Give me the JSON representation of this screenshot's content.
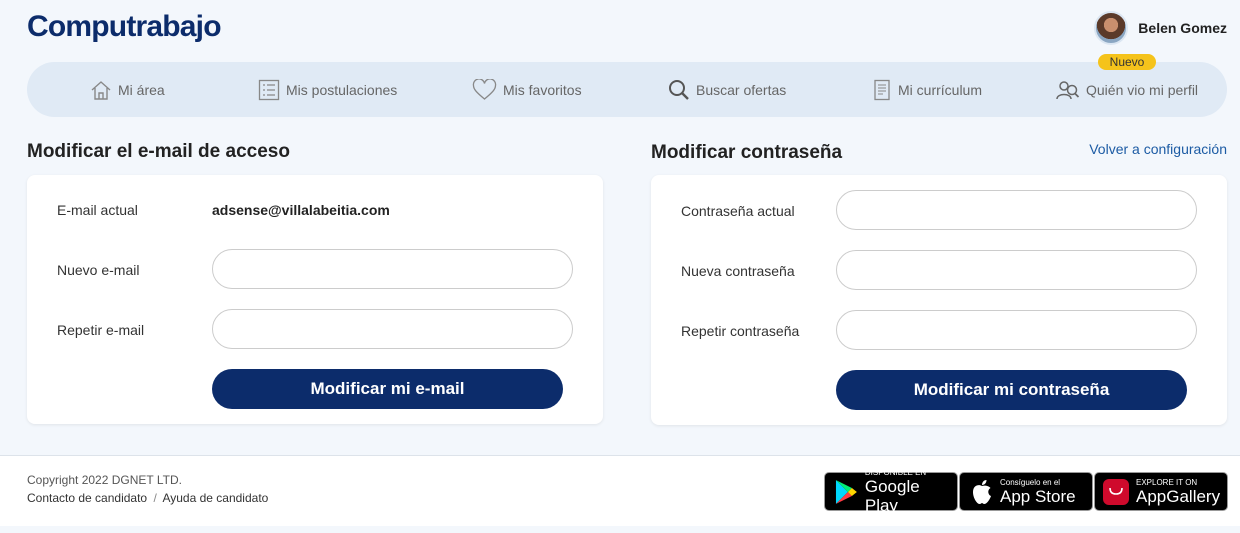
{
  "header": {
    "logo": "Computrabajo",
    "user_name": "Belen Gomez",
    "badge": "Nuevo"
  },
  "nav": {
    "items": [
      {
        "label": "Mi área",
        "icon": "home-icon"
      },
      {
        "label": "Mis postulaciones",
        "icon": "list-icon"
      },
      {
        "label": "Mis favoritos",
        "icon": "heart-icon"
      },
      {
        "label": "Buscar ofertas",
        "icon": "search-icon"
      },
      {
        "label": "Mi currículum",
        "icon": "document-icon"
      },
      {
        "label": "Quién vio mi perfil",
        "icon": "user-search-icon"
      }
    ]
  },
  "email_section": {
    "title": "Modificar el e-mail de acceso",
    "current_label": "E-mail actual",
    "current_value": "adsense@villalabeitia.com",
    "new_label": "Nuevo e-mail",
    "new_value": "",
    "repeat_label": "Repetir e-mail",
    "repeat_value": "",
    "button": "Modificar mi e-mail"
  },
  "password_section": {
    "title": "Modificar contraseña",
    "back_link": "Volver a configuración",
    "current_label": "Contraseña actual",
    "new_label": "Nueva contraseña",
    "repeat_label": "Repetir contraseña",
    "button": "Modificar mi contraseña"
  },
  "footer": {
    "copyright": "Copyright 2022 DGNET LTD.",
    "link_contact": "Contacto de candidato",
    "separator": "/",
    "link_help": "Ayuda de candidato",
    "stores": [
      {
        "small": "DISPONIBLE EN",
        "big": "Google Play",
        "icon": "google-play-icon"
      },
      {
        "small": "Consíguelo en el",
        "big": "App Store",
        "icon": "apple-icon"
      },
      {
        "small": "EXPLORE IT ON",
        "big": "AppGallery",
        "icon": "huawei-icon"
      }
    ]
  }
}
